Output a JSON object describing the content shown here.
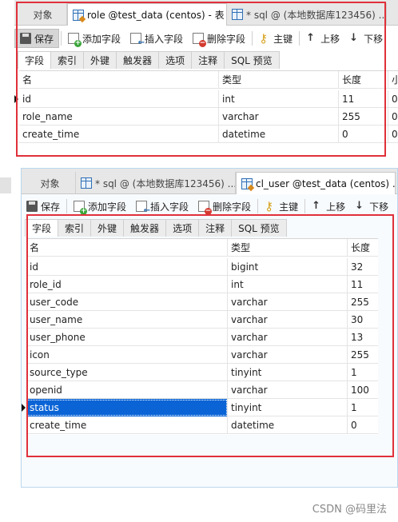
{
  "panel_top": {
    "tabs": [
      "对象",
      "role @test_data (centos) - 表",
      "* sql @ (本地数据库123456) ..."
    ],
    "toolbar": {
      "save": "保存",
      "add_field": "添加字段",
      "insert_field": "插入字段",
      "delete_field": "删除字段",
      "primary_key": "主键",
      "move_up": "上移",
      "move_down": "下移"
    },
    "subtabs": [
      "字段",
      "索引",
      "外键",
      "触发器",
      "选项",
      "注释",
      "SQL 预览"
    ],
    "columns": [
      "名",
      "类型",
      "长度",
      "小"
    ],
    "rows": [
      [
        "id",
        "int",
        "11",
        "0"
      ],
      [
        "role_name",
        "varchar",
        "255",
        "0"
      ],
      [
        "create_time",
        "datetime",
        "0",
        "0"
      ]
    ]
  },
  "panel_bottom": {
    "tabs": [
      "对象",
      "* sql @ (本地数据库123456) ...",
      "cl_user @test_data (centos) ..."
    ],
    "toolbar": {
      "save": "保存",
      "add_field": "添加字段",
      "insert_field": "插入字段",
      "delete_field": "删除字段",
      "primary_key": "主键",
      "move_up": "上移",
      "move_down": "下移"
    },
    "subtabs": [
      "字段",
      "索引",
      "外键",
      "触发器",
      "选项",
      "注释",
      "SQL 预览"
    ],
    "columns": [
      "名",
      "类型",
      "长度"
    ],
    "rows": [
      [
        "id",
        "bigint",
        "32"
      ],
      [
        "role_id",
        "int",
        "11"
      ],
      [
        "user_code",
        "varchar",
        "255"
      ],
      [
        "user_name",
        "varchar",
        "30"
      ],
      [
        "user_phone",
        "varchar",
        "13"
      ],
      [
        "icon",
        "varchar",
        "255"
      ],
      [
        "source_type",
        "tinyint",
        "1"
      ],
      [
        "openid",
        "varchar",
        "100"
      ],
      [
        "status",
        "tinyint",
        "1"
      ],
      [
        "create_time",
        "datetime",
        "0"
      ]
    ],
    "selected_row": 8
  },
  "watermark": "CSDN @码里法",
  "colors": {
    "highlight_box": "#e0303a",
    "selection": "#0a64d6"
  }
}
